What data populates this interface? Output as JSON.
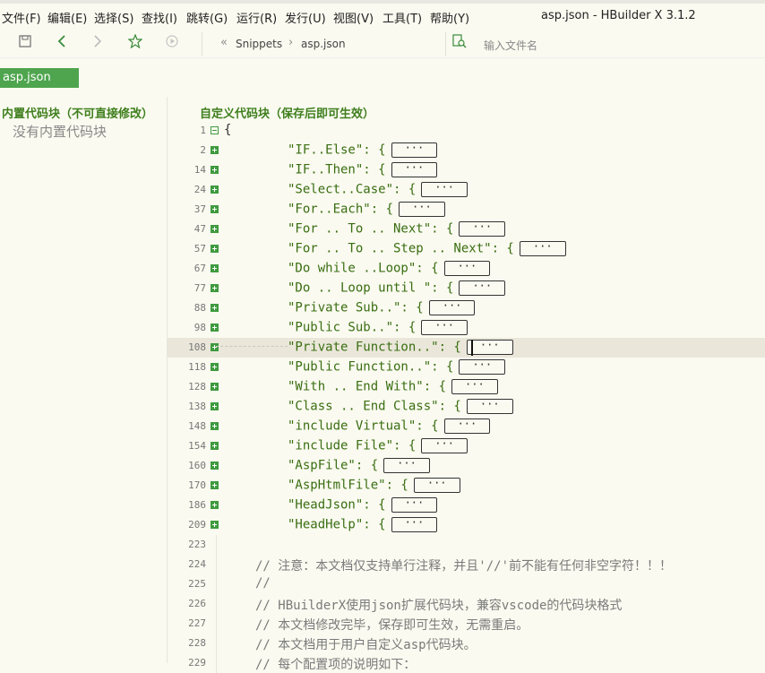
{
  "menu": {
    "file": "文件(F)",
    "edit": "编辑(E)",
    "select": "选择(S)",
    "find": "查找(I)",
    "goto": "跳转(G)",
    "run": "运行(R)",
    "publish": "发行(U)",
    "view": "视图(V)",
    "tools": "工具(T)",
    "help": "帮助(Y)"
  },
  "window_title": "asp.json - HBuilder X 3.1.2",
  "toolbar": {
    "breadcrumb_root": "Snippets",
    "breadcrumb_sep": "›",
    "breadcrumb_file": "asp.json",
    "file_search_placeholder": "输入文件名",
    "icons": [
      "save-icon",
      "back-icon",
      "forward-icon",
      "star-icon",
      "run-icon",
      "breadcrumb-toggle-icon",
      "file-search-icon"
    ]
  },
  "tab": {
    "label": "asp.json",
    "color": "#4ea54e"
  },
  "left_panel": {
    "title": "内置代码块（不可直接修改）",
    "empty_text": "没有内置代码块"
  },
  "editor": {
    "title": "自定义代码块（保存后即可生效）",
    "open_brace": "{",
    "ellipsis": "···",
    "entries": [
      {
        "line": "2",
        "key": "\"IF..Else\": {"
      },
      {
        "line": "14",
        "key": "\"IF..Then\": {"
      },
      {
        "line": "24",
        "key": "\"Select..Case\": {"
      },
      {
        "line": "37",
        "key": "\"For..Each\": {"
      },
      {
        "line": "47",
        "key": "\"For .. To .. Next\": {"
      },
      {
        "line": "57",
        "key": "\"For .. To .. Step .. Next\": {"
      },
      {
        "line": "67",
        "key": "\"Do while ..Loop\": {"
      },
      {
        "line": "77",
        "key": "\"Do .. Loop until \": {"
      },
      {
        "line": "88",
        "key": "\"Private Sub..\": {"
      },
      {
        "line": "98",
        "key": "\"Public Sub..\": {"
      },
      {
        "line": "108",
        "key": "\"Private Function..\": {"
      },
      {
        "line": "118",
        "key": "\"Public Function..\": {"
      },
      {
        "line": "128",
        "key": "\"With .. End With\": {"
      },
      {
        "line": "138",
        "key": "\"Class .. End Class\": {"
      },
      {
        "line": "148",
        "key": "\"include Virtual\": {"
      },
      {
        "line": "154",
        "key": "\"include File\": {"
      },
      {
        "line": "160",
        "key": "\"AspFile\": {"
      },
      {
        "line": "170",
        "key": "\"AspHtmlFile\": {"
      },
      {
        "line": "186",
        "key": "\"HeadJson\": {"
      },
      {
        "line": "209",
        "key": "\"HeadHelp\": {"
      }
    ],
    "first_line": "1",
    "highlighted_line": "108",
    "comments": [
      {
        "line": "223",
        "text": ""
      },
      {
        "line": "224",
        "text": "// 注意：本文档仅支持单行注释，并且'//'前不能有任何非空字符！！！"
      },
      {
        "line": "225",
        "text": "//"
      },
      {
        "line": "226",
        "text": "// HBuilderX使用json扩展代码块，兼容vscode的代码块格式"
      },
      {
        "line": "227",
        "text": "// 本文档修改完毕，保存即可生效，无需重启。"
      },
      {
        "line": "228",
        "text": "// 本文档用于用户自定义asp代码块。"
      },
      {
        "line": "229",
        "text": "// 每个配置项的说明如下："
      }
    ]
  }
}
